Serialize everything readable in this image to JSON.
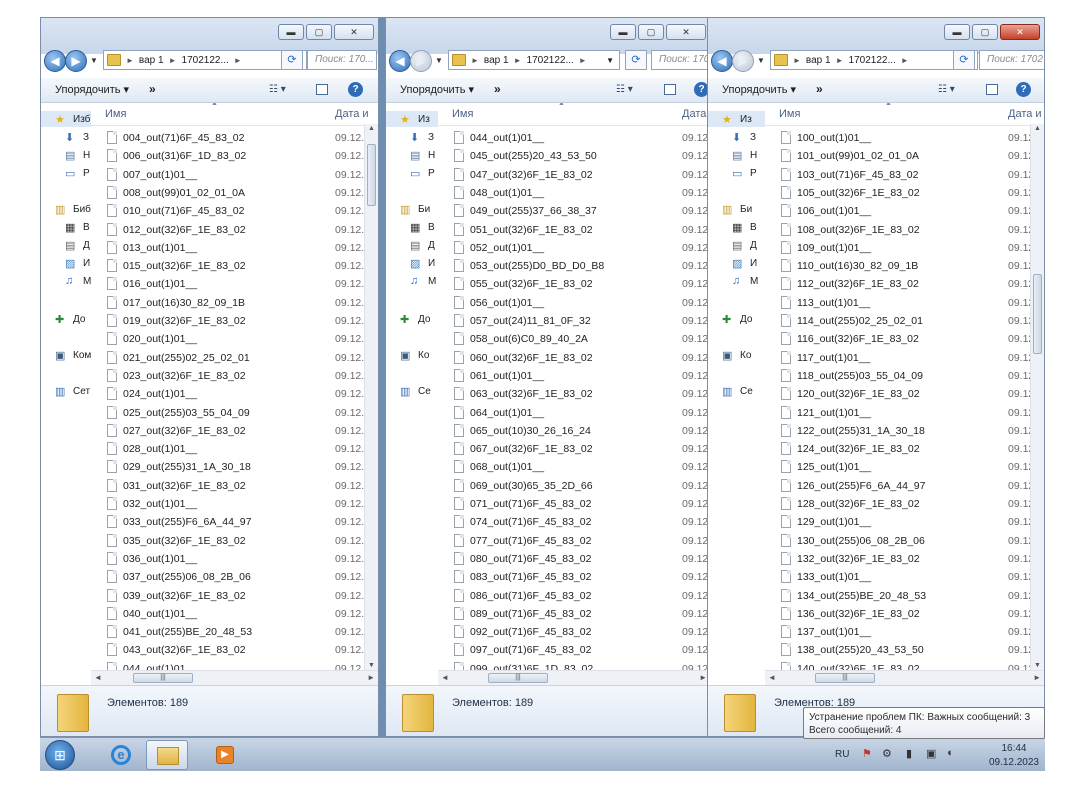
{
  "windows": [
    {
      "address": [
        "вар 1",
        "1702122..."
      ],
      "search_placeholder": "Поиск: 170...",
      "organize_label": "Упорядочить",
      "more_label": "»",
      "col_name": "Имя",
      "col_date": "Дата и",
      "nav_items": [
        "Избранное",
        "Загрузки",
        "Недавние места",
        "Рабочий стол",
        "Библиотеки",
        "Видео",
        "Документы",
        "Изображения",
        "Музыка",
        "Домашняя группа",
        "Компьютер",
        "Сеть"
      ],
      "nav_visible": [
        "Изб",
        "З",
        "Н",
        "Р",
        "Биб",
        "В",
        "Д",
        "И",
        "М",
        "До",
        "Ком",
        "Сет"
      ],
      "files": [
        {
          "name": "004_out(71)6F_45_83_02",
          "date": "09.12."
        },
        {
          "name": "006_out(31)6F_1D_83_02",
          "date": "09.12."
        },
        {
          "name": "007_out(1)01__",
          "date": "09.12."
        },
        {
          "name": "008_out(99)01_02_01_0A",
          "date": "09.12."
        },
        {
          "name": "010_out(71)6F_45_83_02",
          "date": "09.12."
        },
        {
          "name": "012_out(32)6F_1E_83_02",
          "date": "09.12."
        },
        {
          "name": "013_out(1)01__",
          "date": "09.12."
        },
        {
          "name": "015_out(32)6F_1E_83_02",
          "date": "09.12."
        },
        {
          "name": "016_out(1)01__",
          "date": "09.12."
        },
        {
          "name": "017_out(16)30_82_09_1B",
          "date": "09.12."
        },
        {
          "name": "019_out(32)6F_1E_83_02",
          "date": "09.12."
        },
        {
          "name": "020_out(1)01__",
          "date": "09.12."
        },
        {
          "name": "021_out(255)02_25_02_01",
          "date": "09.12."
        },
        {
          "name": "023_out(32)6F_1E_83_02",
          "date": "09.12."
        },
        {
          "name": "024_out(1)01__",
          "date": "09.12."
        },
        {
          "name": "025_out(255)03_55_04_09",
          "date": "09.12."
        },
        {
          "name": "027_out(32)6F_1E_83_02",
          "date": "09.12."
        },
        {
          "name": "028_out(1)01__",
          "date": "09.12."
        },
        {
          "name": "029_out(255)31_1A_30_18",
          "date": "09.12."
        },
        {
          "name": "031_out(32)6F_1E_83_02",
          "date": "09.12."
        },
        {
          "name": "032_out(1)01__",
          "date": "09.12."
        },
        {
          "name": "033_out(255)F6_6A_44_97",
          "date": "09.12."
        },
        {
          "name": "035_out(32)6F_1E_83_02",
          "date": "09.12."
        },
        {
          "name": "036_out(1)01__",
          "date": "09.12."
        },
        {
          "name": "037_out(255)06_08_2B_06",
          "date": "09.12."
        },
        {
          "name": "039_out(32)6F_1E_83_02",
          "date": "09.12."
        },
        {
          "name": "040_out(1)01__",
          "date": "09.12."
        },
        {
          "name": "041_out(255)BE_20_48_53",
          "date": "09.12."
        },
        {
          "name": "043_out(32)6F_1E_83_02",
          "date": "09.12."
        },
        {
          "name": "044_out(1)01__",
          "date": "09.12."
        }
      ],
      "item_count": "Элементов: 189"
    },
    {
      "address": [
        "вар 1",
        "1702122..."
      ],
      "search_placeholder": "Поиск: 170",
      "organize_label": "Упорядочить",
      "more_label": "»",
      "col_name": "Имя",
      "col_date": "Дата",
      "nav_items": [
        "Избранное",
        "Загрузки",
        "Недавние места",
        "Рабочий стол",
        "Библиотеки",
        "Видео",
        "Документы",
        "Изображения",
        "Музыка",
        "Домашняя группа",
        "Компьютер",
        "Сеть"
      ],
      "nav_visible": [
        "Из",
        "З",
        "Н",
        "Р",
        "Би",
        "В",
        "Д",
        "И",
        "М",
        "До",
        "Ко",
        "Се"
      ],
      "files": [
        {
          "name": "044_out(1)01__",
          "date": "09.12"
        },
        {
          "name": "045_out(255)20_43_53_50",
          "date": "09.12"
        },
        {
          "name": "047_out(32)6F_1E_83_02",
          "date": "09.12"
        },
        {
          "name": "048_out(1)01__",
          "date": "09.12"
        },
        {
          "name": "049_out(255)37_66_38_37",
          "date": "09.12"
        },
        {
          "name": "051_out(32)6F_1E_83_02",
          "date": "09.12"
        },
        {
          "name": "052_out(1)01__",
          "date": "09.12"
        },
        {
          "name": "053_out(255)D0_BD_D0_B8",
          "date": "09.12"
        },
        {
          "name": "055_out(32)6F_1E_83_02",
          "date": "09.12"
        },
        {
          "name": "056_out(1)01__",
          "date": "09.12"
        },
        {
          "name": "057_out(24)11_81_0F_32",
          "date": "09.12"
        },
        {
          "name": "058_out(6)C0_89_40_2A",
          "date": "09.12"
        },
        {
          "name": "060_out(32)6F_1E_83_02",
          "date": "09.12"
        },
        {
          "name": "061_out(1)01__",
          "date": "09.12"
        },
        {
          "name": "063_out(32)6F_1E_83_02",
          "date": "09.12"
        },
        {
          "name": "064_out(1)01__",
          "date": "09.12"
        },
        {
          "name": "065_out(10)30_26_16_24",
          "date": "09.12"
        },
        {
          "name": "067_out(32)6F_1E_83_02",
          "date": "09.12"
        },
        {
          "name": "068_out(1)01__",
          "date": "09.12"
        },
        {
          "name": "069_out(30)65_35_2D_66",
          "date": "09.12"
        },
        {
          "name": "071_out(71)6F_45_83_02",
          "date": "09.12"
        },
        {
          "name": "074_out(71)6F_45_83_02",
          "date": "09.12"
        },
        {
          "name": "077_out(71)6F_45_83_02",
          "date": "09.12"
        },
        {
          "name": "080_out(71)6F_45_83_02",
          "date": "09.12"
        },
        {
          "name": "083_out(71)6F_45_83_02",
          "date": "09.12"
        },
        {
          "name": "086_out(71)6F_45_83_02",
          "date": "09.12"
        },
        {
          "name": "089_out(71)6F_45_83_02",
          "date": "09.12"
        },
        {
          "name": "092_out(71)6F_45_83_02",
          "date": "09.12"
        },
        {
          "name": "097_out(71)6F_45_83_02",
          "date": "09.12"
        },
        {
          "name": "099_out(31)6F_1D_83_02",
          "date": "09.12"
        }
      ],
      "item_count": "Элементов: 189"
    },
    {
      "address": [
        "вар 1",
        "1702122..."
      ],
      "search_placeholder": "Поиск: 1702",
      "organize_label": "Упорядочить",
      "more_label": "»",
      "col_name": "Имя",
      "col_date": "Дата и",
      "nav_items": [
        "Избранное",
        "Загрузки",
        "Недавние места",
        "Рабочий стол",
        "Библиотеки",
        "Видео",
        "Документы",
        "Изображения",
        "Музыка",
        "Домашняя группа",
        "Компьютер",
        "Сеть"
      ],
      "nav_visible": [
        "Из",
        "З",
        "Н",
        "Р",
        "Би",
        "В",
        "Д",
        "И",
        "М",
        "До",
        "Ко",
        "Се"
      ],
      "files": [
        {
          "name": "100_out(1)01__",
          "date": "09.12."
        },
        {
          "name": "101_out(99)01_02_01_0A",
          "date": "09.12."
        },
        {
          "name": "103_out(71)6F_45_83_02",
          "date": "09.12."
        },
        {
          "name": "105_out(32)6F_1E_83_02",
          "date": "09.12."
        },
        {
          "name": "106_out(1)01__",
          "date": "09.12."
        },
        {
          "name": "108_out(32)6F_1E_83_02",
          "date": "09.12."
        },
        {
          "name": "109_out(1)01__",
          "date": "09.12."
        },
        {
          "name": "110_out(16)30_82_09_1B",
          "date": "09.12."
        },
        {
          "name": "112_out(32)6F_1E_83_02",
          "date": "09.12."
        },
        {
          "name": "113_out(1)01__",
          "date": "09.12."
        },
        {
          "name": "114_out(255)02_25_02_01",
          "date": "09.12."
        },
        {
          "name": "116_out(32)6F_1E_83_02",
          "date": "09.12."
        },
        {
          "name": "117_out(1)01__",
          "date": "09.12."
        },
        {
          "name": "118_out(255)03_55_04_09",
          "date": "09.12."
        },
        {
          "name": "120_out(32)6F_1E_83_02",
          "date": "09.12."
        },
        {
          "name": "121_out(1)01__",
          "date": "09.12."
        },
        {
          "name": "122_out(255)31_1A_30_18",
          "date": "09.12."
        },
        {
          "name": "124_out(32)6F_1E_83_02",
          "date": "09.12."
        },
        {
          "name": "125_out(1)01__",
          "date": "09.12."
        },
        {
          "name": "126_out(255)F6_6A_44_97",
          "date": "09.12."
        },
        {
          "name": "128_out(32)6F_1E_83_02",
          "date": "09.12."
        },
        {
          "name": "129_out(1)01__",
          "date": "09.12."
        },
        {
          "name": "130_out(255)06_08_2B_06",
          "date": "09.12."
        },
        {
          "name": "132_out(32)6F_1E_83_02",
          "date": "09.12."
        },
        {
          "name": "133_out(1)01__",
          "date": "09.12."
        },
        {
          "name": "134_out(255)BE_20_48_53",
          "date": "09.12."
        },
        {
          "name": "136_out(32)6F_1E_83_02",
          "date": "09.12."
        },
        {
          "name": "137_out(1)01__",
          "date": "09.12."
        },
        {
          "name": "138_out(255)20_43_53_50",
          "date": "09.12."
        },
        {
          "name": "140_out(32)6F_1E_83_02",
          "date": "09.12."
        }
      ],
      "item_count": "Элементов: 189"
    }
  ],
  "taskbar": {
    "language": "RU",
    "time": "16:44",
    "date": "09.12.2023"
  },
  "tooltip": {
    "line1": "Устранение проблем ПК: Важных сообщений: 3",
    "line2": "Всего сообщений: 4"
  },
  "icons": {
    "back": "back-arrow-icon",
    "forward": "forward-arrow-icon",
    "refresh": "refresh-icon",
    "view": "view-options-icon",
    "preview": "preview-pane-icon",
    "help": "help-icon",
    "file": "file-icon",
    "folder": "folder-icon"
  },
  "colors": {
    "desktop": "#6d8db3",
    "accent": "#2f6cb8",
    "close_button": "#c4402a"
  }
}
